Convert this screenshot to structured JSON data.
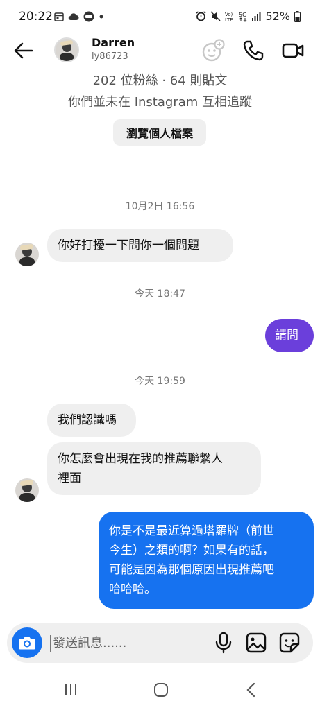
{
  "status_bar": {
    "time": "20:22",
    "battery": "52%"
  },
  "header": {
    "name": "Darren",
    "username": "ly86723"
  },
  "profile": {
    "stats": "202 位粉絲 · 64 則貼文",
    "mutual": "你們並未在 Instagram 互相追蹤",
    "view_button": "瀏覽個人檔案"
  },
  "timestamps": [
    "10月2日 16:56",
    "今天 18:47",
    "今天 19:59"
  ],
  "messages": {
    "m1": "你好打擾一下問你一個問題",
    "m2": "請問",
    "m3": "我們認識嗎",
    "m4_line1": "你怎麼會出現在我的推薦聯繫人",
    "m4_line2": "裡面",
    "m5_line1": "你是不是最近算過塔羅牌（前世",
    "m5_line2": "今生）之類的啊？如果有的話，",
    "m5_line3": "可能是因為那個原因出現推薦吧",
    "m5_line4": "哈哈哈。"
  },
  "composer": {
    "placeholder": "發送訊息......"
  },
  "colors": {
    "purple_bubble": "#6b3fdb",
    "blue_bubble": "#1672f0",
    "incoming_bubble": "#efefef"
  },
  "icons": [
    "back-arrow-icon",
    "dm-effects-icon",
    "phone-icon",
    "video-icon",
    "camera-icon",
    "microphone-icon",
    "gallery-icon",
    "sticker-icon"
  ]
}
